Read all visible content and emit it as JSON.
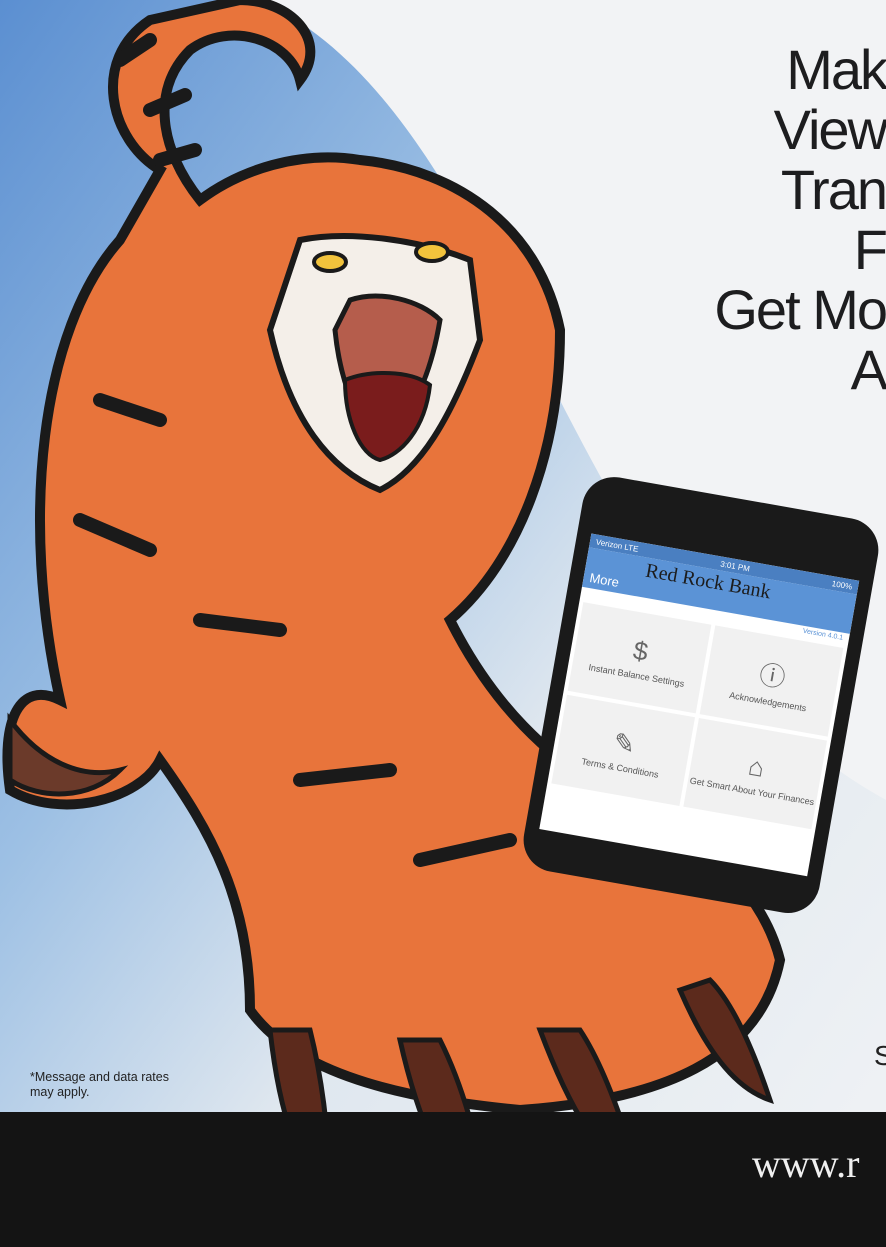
{
  "poster": {
    "headline_lines": [
      "Mak",
      "View",
      "Tran",
      "F",
      "Get Mo",
      "A"
    ],
    "disclaimer": "*Message and data rates may apply.",
    "url": "www.r",
    "partial_side_text": "S"
  },
  "phone": {
    "status_left": "Verizon LTE",
    "status_time": "3:01 PM",
    "status_right": "100%",
    "bank_name": "Red Rock Bank",
    "menu_title": "More",
    "version": "Version 4.0.1",
    "tiles": [
      {
        "label": "Instant Balance Settings",
        "icon": "dollar-icon"
      },
      {
        "label": "Acknowledgements",
        "icon": "info-icon"
      },
      {
        "label": "Terms & Conditions",
        "icon": "document-icon"
      },
      {
        "label": "Get Smart About Your Finances",
        "icon": "bank-icon"
      }
    ]
  },
  "colors": {
    "tiger_orange": "#e8743b",
    "phone_header_blue": "#5b93d6",
    "footer_black": "#141414"
  }
}
